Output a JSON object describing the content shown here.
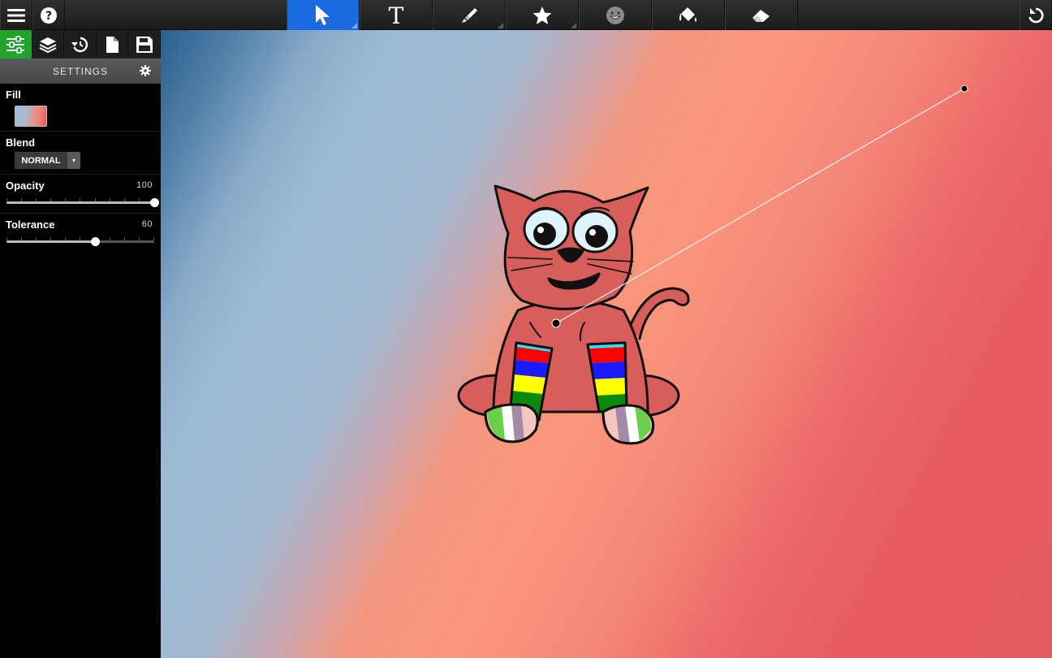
{
  "toolbar": {
    "menu_icon": "hamburger-menu-icon",
    "help_icon": "help-circle-icon",
    "tools": [
      {
        "name": "select",
        "icon": "cursor-arrow-icon",
        "active": true
      },
      {
        "name": "text",
        "icon": "text-T-icon",
        "active": false
      },
      {
        "name": "brush",
        "icon": "brush-icon",
        "active": false
      },
      {
        "name": "shapes",
        "icon": "star-icon",
        "active": false
      },
      {
        "name": "stickers",
        "icon": "smiley-face-icon",
        "active": false
      },
      {
        "name": "fill",
        "icon": "paint-bucket-icon",
        "active": false
      },
      {
        "name": "eraser",
        "icon": "eraser-icon",
        "active": false
      }
    ],
    "undo_icon": "undo-icon",
    "accent_color": "#1a6be0"
  },
  "sidebar": {
    "tabs": [
      {
        "name": "settings",
        "icon": "sliders-icon",
        "active": true
      },
      {
        "name": "layers",
        "icon": "layers-icon",
        "active": false
      },
      {
        "name": "history",
        "icon": "history-icon",
        "active": false
      },
      {
        "name": "document",
        "icon": "document-icon",
        "active": false
      },
      {
        "name": "save",
        "icon": "floppy-disk-icon",
        "active": false
      }
    ],
    "active_tab_color": "#1fa32b",
    "header": "SETTINGS",
    "fill": {
      "label": "Fill",
      "gradient_colors": [
        "#9dbcd6",
        "#e65c60"
      ]
    },
    "blend": {
      "label": "Blend",
      "value": "NORMAL"
    },
    "opacity": {
      "label": "Opacity",
      "value": "100",
      "fraction": 1.0
    },
    "tolerance": {
      "label": "Tolerance",
      "value": "60",
      "fraction": 0.6
    }
  },
  "canvas": {
    "gradient_start_color": "#2a5f8e",
    "gradient_end_color": "#e55c60",
    "content": "cat-with-striped-socks-drawing"
  }
}
